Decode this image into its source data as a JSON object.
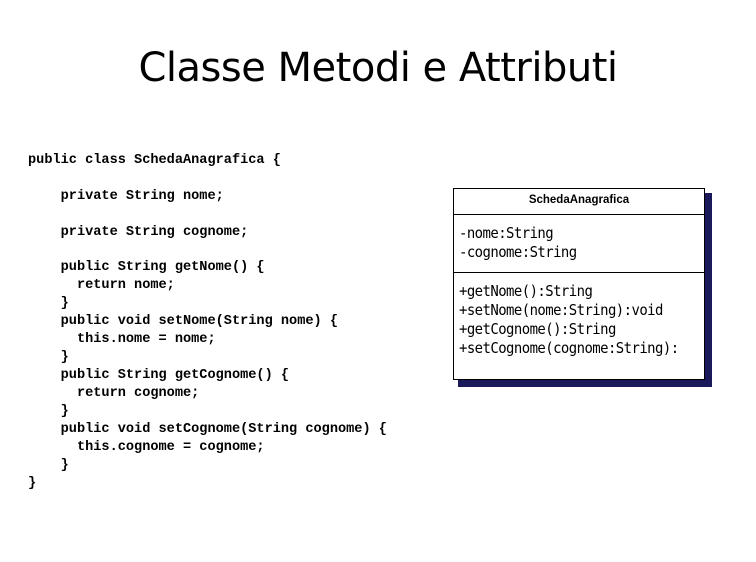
{
  "slide": {
    "title": "Classe Metodi e Attributi"
  },
  "code": {
    "lines": [
      "public class SchedaAnagrafica {",
      "    private String nome;",
      "    private String cognome;",
      "    public String getNome() {",
      "      return nome;",
      "    }",
      "    public void setNome(String nome) {",
      "      this.nome = nome;",
      "    }",
      "    public String getCognome() {",
      "      return cognome;",
      "    }",
      "    public void setCognome(String cognome) {",
      "      this.cognome = cognome;",
      "    }",
      "}"
    ]
  },
  "uml": {
    "class_name": "SchedaAnagrafica",
    "attributes": [
      "-nome:String",
      "-cognome:String"
    ],
    "operations": [
      "+getNome():String",
      "+setNome(nome:String):void",
      "+getCognome():String",
      "+setCognome(cognome:String):"
    ],
    "shadow_color": "#1a1a5a"
  }
}
